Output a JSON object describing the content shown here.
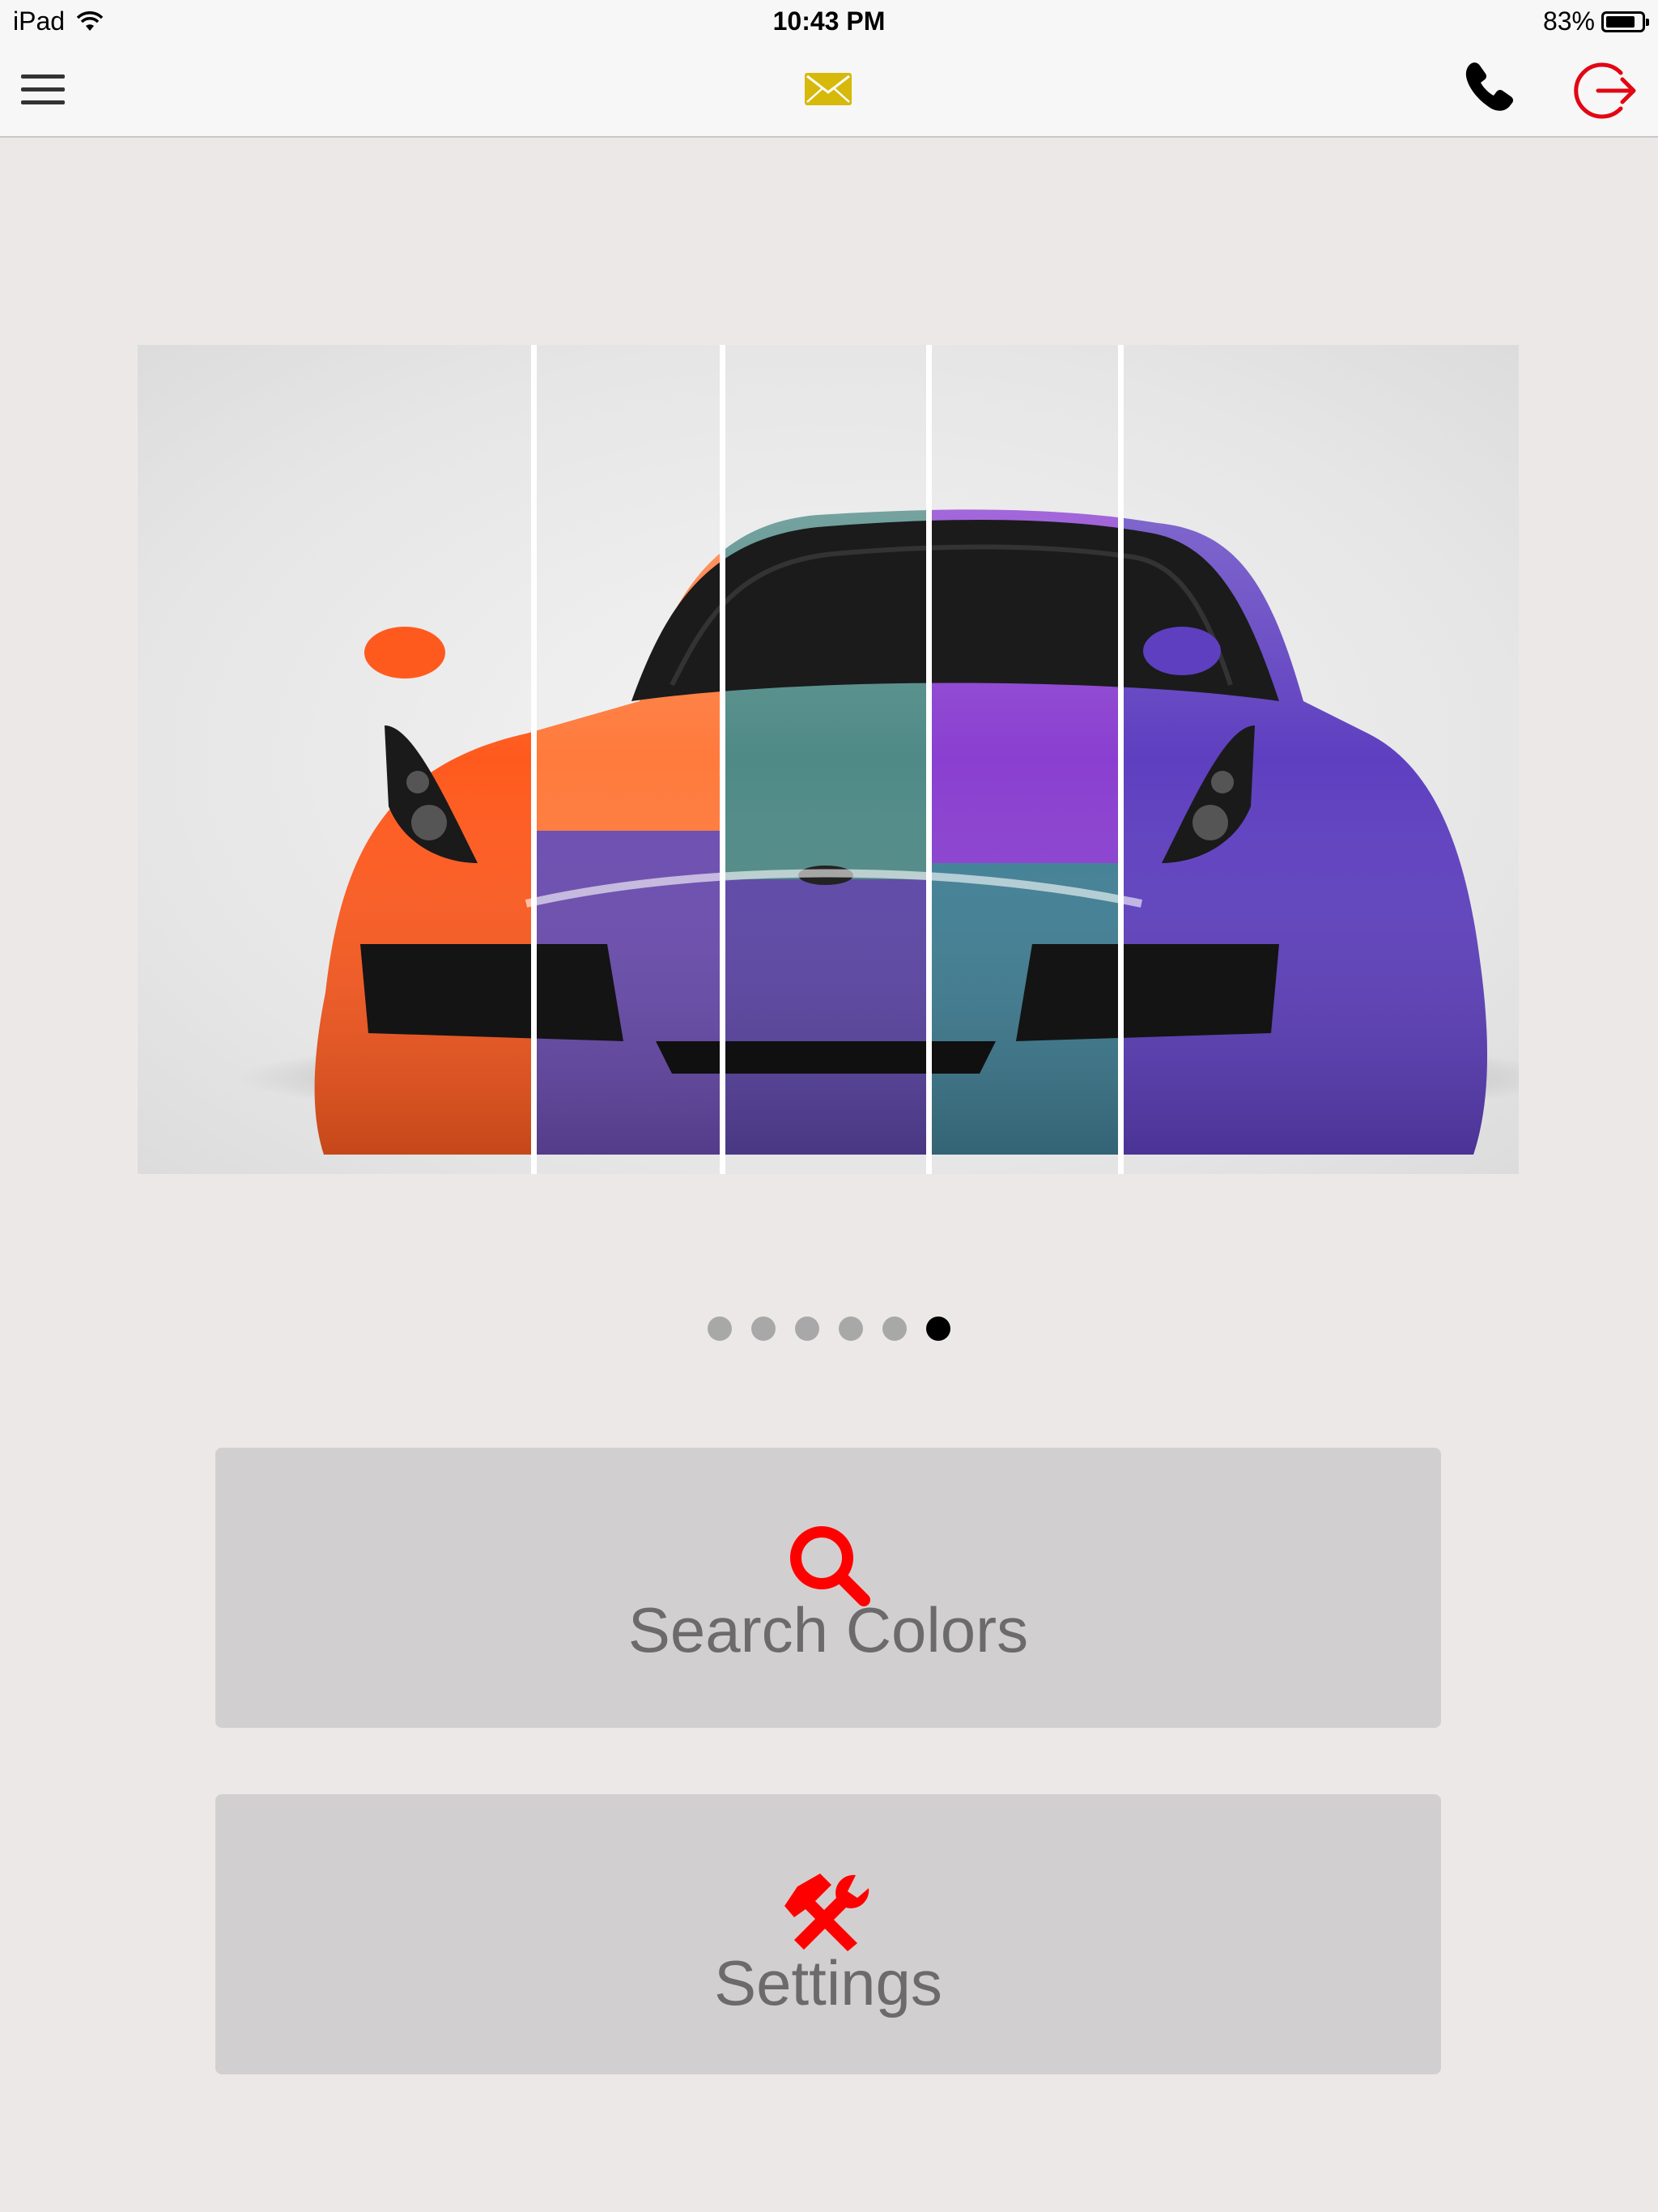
{
  "status": {
    "device": "iPad",
    "time": "10:43 PM",
    "battery_percent": "83%",
    "battery_level": 0.83
  },
  "nav": {
    "menu_icon": "hamburger-icon",
    "mail_icon": "mail-icon",
    "phone_icon": "phone-icon",
    "logout_icon": "logout-icon",
    "accent_color": "#e30613",
    "mail_color": "#d4b800"
  },
  "carousel": {
    "slide_count": 6,
    "active_index": 5,
    "image": "multi-color-sports-car"
  },
  "buttons": {
    "search": {
      "label": "Search Colors",
      "icon": "search-icon"
    },
    "settings": {
      "label": "Settings",
      "icon": "tools-icon"
    }
  }
}
